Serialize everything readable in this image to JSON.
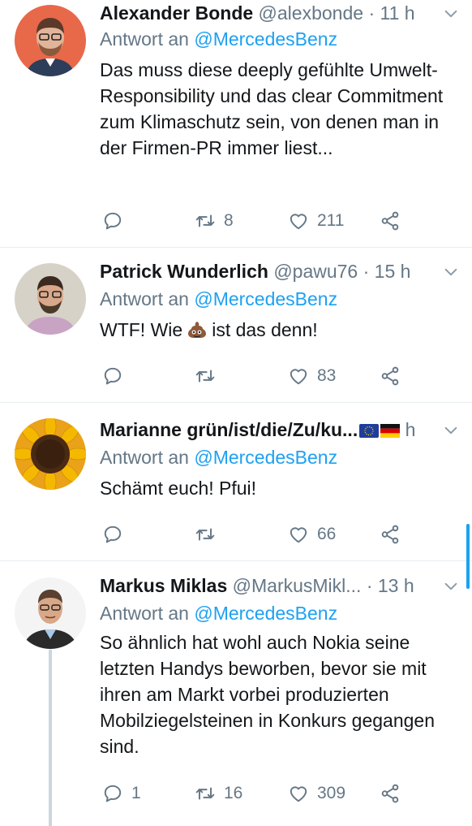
{
  "tweets": [
    {
      "name": "Alexander Bonde",
      "handle": "@alexbonde",
      "time": "· 11 h",
      "reply_label": "Antwort an",
      "reply_to": "@MercedesBenz",
      "text": "Das muss diese deeply gefühlte Umwelt-Responsibility und das clear Commitment zum Klimaschutz sein, von denen man in der Firmen-PR immer liest...",
      "replies": "",
      "retweets": "8",
      "likes": "211"
    },
    {
      "name": "Patrick Wunderlich",
      "handle": "@pawu76",
      "time": "· 15 h",
      "reply_label": "Antwort an",
      "reply_to": "@MercedesBenz",
      "text_before": "WTF! Wie",
      "emoji": "pile-of-poo",
      "text_after": "ist das denn!",
      "replies": "",
      "retweets": "",
      "likes": "83"
    },
    {
      "name": "Marianne grün/ist/die/Zu/ku...",
      "flags": [
        "eu-flag",
        "germany-flag"
      ],
      "time": "h",
      "reply_label": "Antwort an",
      "reply_to": "@MercedesBenz",
      "text": "Schämt euch! Pfui!",
      "replies": "",
      "retweets": "",
      "likes": "66"
    },
    {
      "name": "Markus Miklas",
      "handle": "@MarkusMikl...",
      "time": "· 13 h",
      "reply_label": "Antwort an",
      "reply_to": "@MercedesBenz",
      "text": "So ähnlich hat wohl auch Nokia seine letzten Handys beworben, bevor sie mit ihren am Markt vorbei produzierten Mobilziegelsteinen in Konkurs gegangen sind.",
      "replies": "1",
      "retweets": "16",
      "likes": "309"
    }
  ],
  "colors": {
    "accent": "#1da1f2",
    "secondary_text": "#657786",
    "divider": "#e6ecf0"
  }
}
